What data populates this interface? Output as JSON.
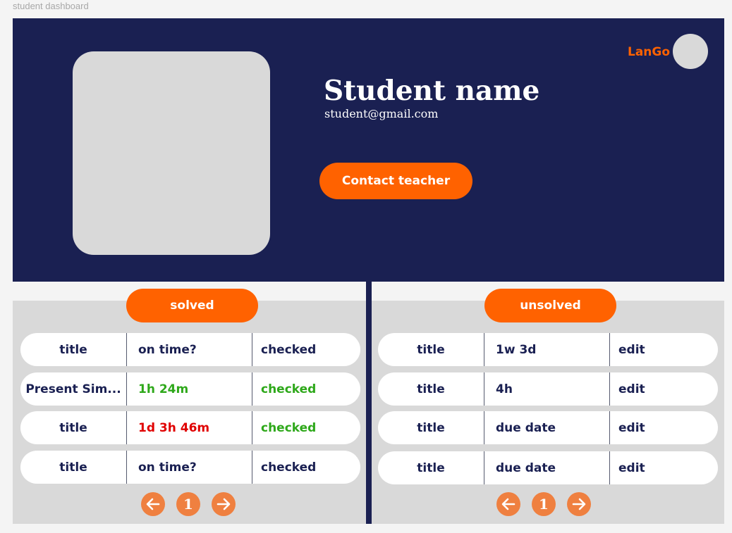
{
  "frame_label": "student dashboard",
  "header": {
    "brand": "LanGo",
    "student_name": "Student name",
    "student_email": "student@gmail.com",
    "contact_button": "Contact teacher"
  },
  "tabs": {
    "solved": "solved",
    "unsolved": "unsolved"
  },
  "solved_table": {
    "rows": [
      {
        "title": "title",
        "status": "on time?",
        "checked": "checked"
      },
      {
        "title": "Present Sim...",
        "status": "1h 24m",
        "checked": "checked"
      },
      {
        "title": "title",
        "status": "1d 3h 46m",
        "checked": "checked"
      },
      {
        "title": "title",
        "status": "on time?",
        "checked": "checked"
      }
    ],
    "pager": {
      "page": "1"
    }
  },
  "unsolved_table": {
    "rows": [
      {
        "title": "title",
        "due": "1w 3d",
        "action": "edit"
      },
      {
        "title": "title",
        "due": "4h",
        "action": "edit"
      },
      {
        "title": "title",
        "due": "due date",
        "action": "edit"
      },
      {
        "title": "title",
        "due": "due date",
        "action": "edit"
      }
    ],
    "pager": {
      "page": "1"
    }
  },
  "colors": {
    "navy": "#1a2052",
    "orange": "#ff6200",
    "green": "#2ea81a",
    "red": "#e00000"
  }
}
